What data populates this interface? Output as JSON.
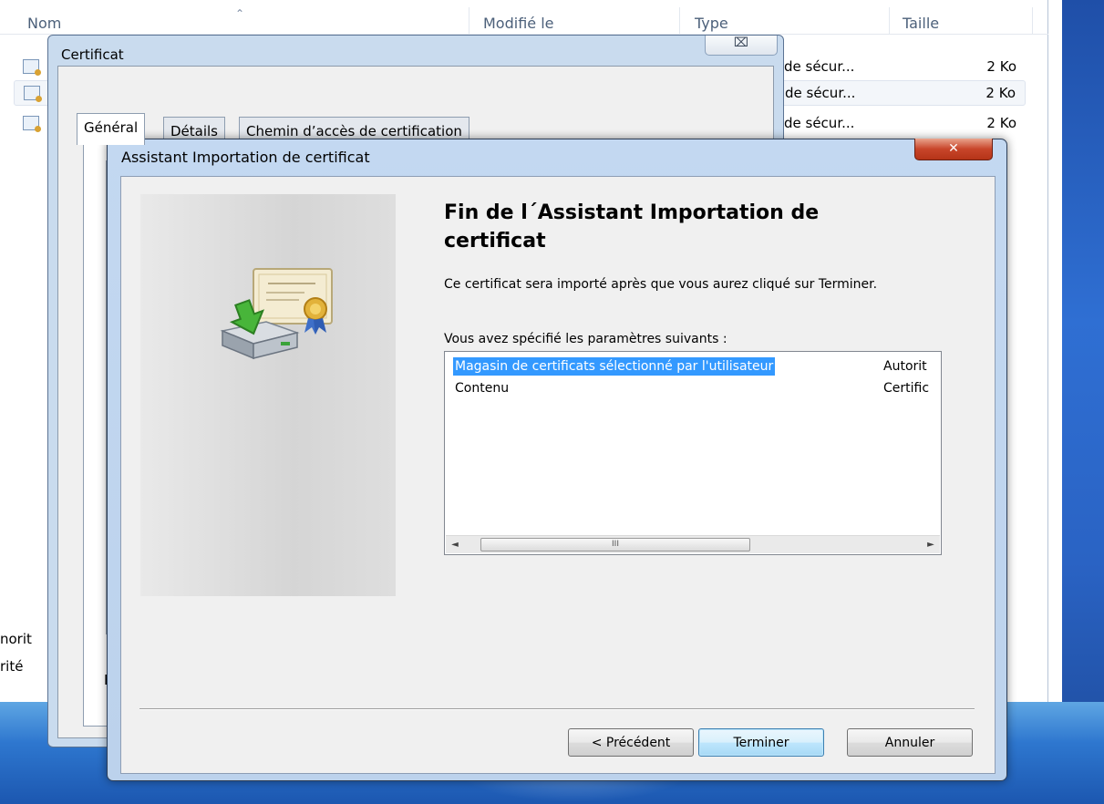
{
  "explorer": {
    "columns": {
      "name": "Nom",
      "modified": "Modifié le",
      "type": "Type",
      "size": "Taille"
    },
    "rows": [
      {
        "type": "de sécur...",
        "size": "2 Ko"
      },
      {
        "type": "de sécur...",
        "size": "2 Ko"
      },
      {
        "type": "de sécur...",
        "size": "2 Ko"
      }
    ],
    "left_fragments": {
      "line1": "norit",
      "line2": "rité"
    }
  },
  "certificate_dialog": {
    "title": "Certificat",
    "close_glyph": "⌧",
    "tabs": [
      "Général",
      "Détails",
      "Chemin d’accès de certification"
    ],
    "partial_text": "E"
  },
  "wizard": {
    "title": "Assistant Importation de certificat",
    "close_glyph": "✕",
    "heading": "Fin de l´Assistant Importation de certificat",
    "description": "Ce certificat sera importé après que vous aurez cliqué sur Terminer.",
    "params_label": "Vous avez spécifié les paramètres suivants :",
    "settings": [
      {
        "name": "Magasin de certificats sélectionné par l'utilisateur",
        "value": "Autorit",
        "selected": true
      },
      {
        "name": "Contenu",
        "value": "Certific",
        "selected": false
      }
    ],
    "scrollbar": {
      "left": "◄",
      "thumb": "III",
      "right": "►"
    },
    "buttons": {
      "back": "< Précédent",
      "finish": "Terminer",
      "cancel": "Annuler"
    }
  },
  "colors": {
    "selection": "#3399ff",
    "close_red": "#c8452a",
    "frame_blue": "#bcd2ec"
  }
}
